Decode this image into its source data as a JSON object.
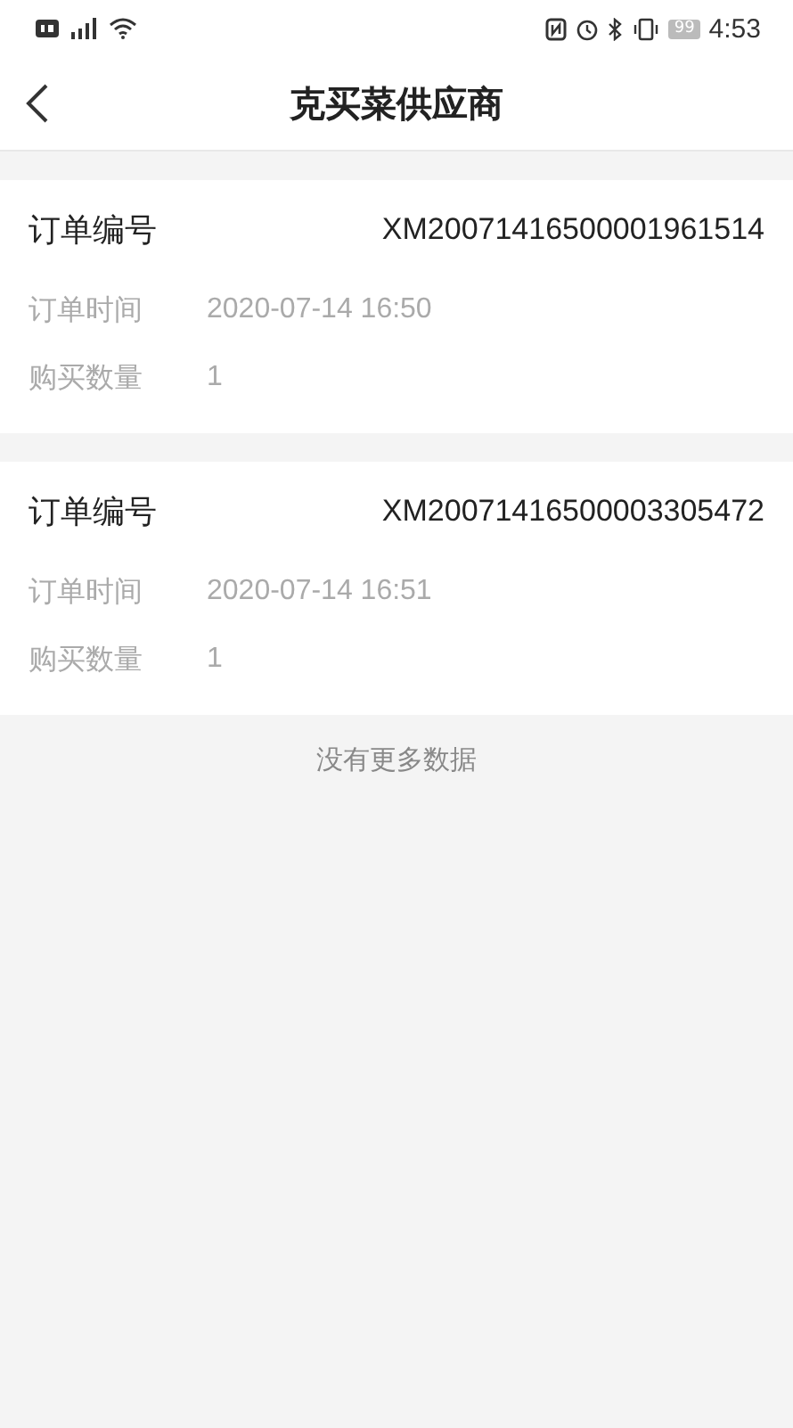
{
  "status_bar": {
    "battery": "99",
    "time": "4:53"
  },
  "header": {
    "title": "克买菜供应商"
  },
  "orders": [
    {
      "number_label": "订单编号",
      "number": "XM20071416500001961514",
      "fields": [
        {
          "label": "订单时间",
          "value": "2020-07-14 16:50"
        },
        {
          "label": "购买数量",
          "value": "1"
        }
      ]
    },
    {
      "number_label": "订单编号",
      "number": "XM20071416500003305472",
      "fields": [
        {
          "label": "订单时间",
          "value": "2020-07-14 16:51"
        },
        {
          "label": "购买数量",
          "value": "1"
        }
      ]
    }
  ],
  "footer": "没有更多数据"
}
